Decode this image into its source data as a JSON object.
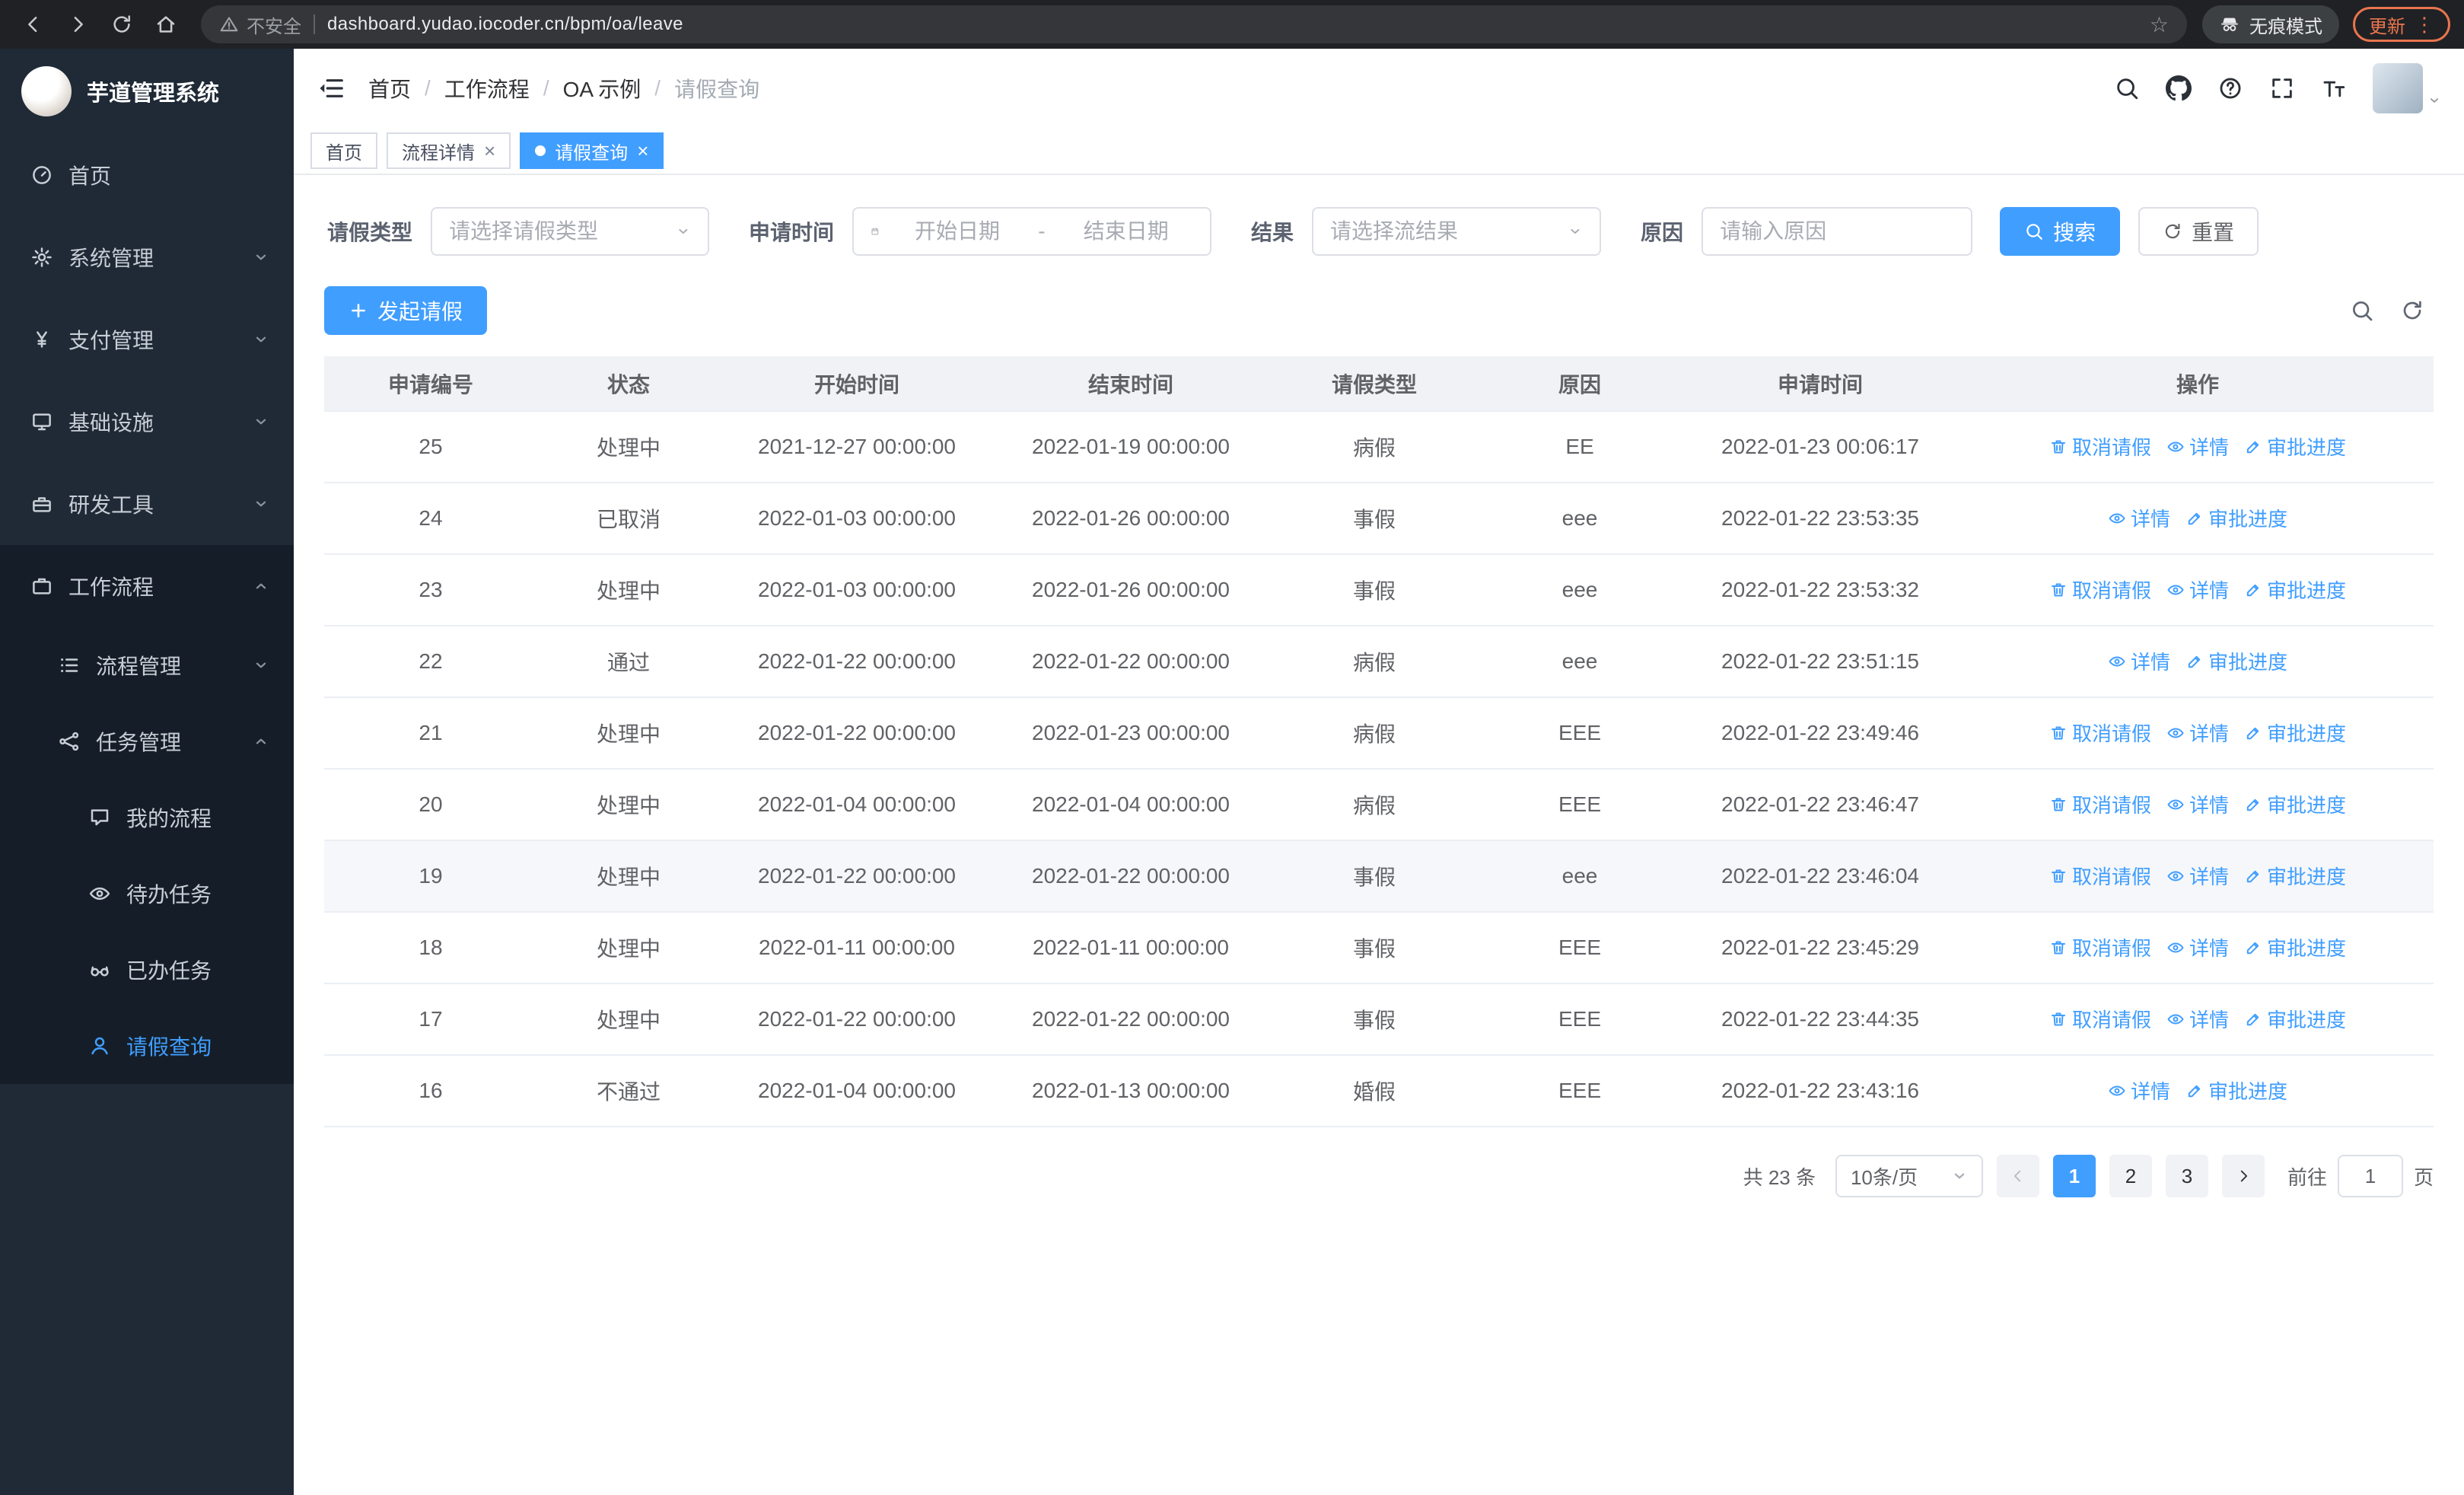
{
  "browser": {
    "security_label": "不安全",
    "url": "dashboard.yudao.iocoder.cn/bpm/oa/leave",
    "incognito_label": "无痕模式",
    "update_label": "更新"
  },
  "sidebar": {
    "title": "芋道管理系统",
    "items": [
      {
        "label": "首页",
        "icon": "dashboard-icon"
      },
      {
        "label": "系统管理",
        "icon": "gear-icon"
      },
      {
        "label": "支付管理",
        "icon": "yen-icon"
      },
      {
        "label": "基础设施",
        "icon": "monitor-icon"
      },
      {
        "label": "研发工具",
        "icon": "toolbox-icon"
      },
      {
        "label": "工作流程",
        "icon": "briefcase-icon"
      },
      {
        "label": "流程管理",
        "icon": "list-icon"
      },
      {
        "label": "任务管理",
        "icon": "node-icon"
      },
      {
        "label": "我的流程",
        "icon": "chat-icon"
      },
      {
        "label": "待办任务",
        "icon": "eye-icon"
      },
      {
        "label": "已办任务",
        "icon": "glasses-icon"
      },
      {
        "label": "请假查询",
        "icon": "user-icon"
      }
    ]
  },
  "header": {
    "breadcrumb": [
      "首页",
      "工作流程",
      "OA 示例",
      "请假查询"
    ],
    "icons": [
      "search-icon",
      "github-icon",
      "question-icon",
      "fullscreen-icon",
      "font-size-icon"
    ]
  },
  "tags": [
    {
      "label": "首页"
    },
    {
      "label": "流程详情"
    },
    {
      "label": "请假查询"
    }
  ],
  "filters": {
    "leave_type_label": "请假类型",
    "leave_type_placeholder": "请选择请假类型",
    "apply_time_label": "申请时间",
    "date_start_placeholder": "开始日期",
    "date_separator": "-",
    "date_end_placeholder": "结束日期",
    "result_label": "结果",
    "result_placeholder": "请选择流结果",
    "reason_label": "原因",
    "reason_placeholder": "请输入原因",
    "search_label": "搜索",
    "reset_label": "重置"
  },
  "toolbar": {
    "create_label": "发起请假"
  },
  "table": {
    "columns": [
      "申请编号",
      "状态",
      "开始时间",
      "结束时间",
      "请假类型",
      "原因",
      "申请时间",
      "操作"
    ],
    "action_labels": {
      "cancel": "取消请假",
      "detail": "详情",
      "progress": "审批进度"
    },
    "action_icons": {
      "cancel": "delete-icon",
      "detail": "view-icon",
      "progress": "edit-icon"
    },
    "rows": [
      {
        "id": "25",
        "status": "处理中",
        "start": "2021-12-27 00:00:00",
        "end": "2022-01-19 00:00:00",
        "type": "病假",
        "reason": "EE",
        "apply_time": "2022-01-23 00:06:17",
        "cancelable": true
      },
      {
        "id": "24",
        "status": "已取消",
        "start": "2022-01-03 00:00:00",
        "end": "2022-01-26 00:00:00",
        "type": "事假",
        "reason": "eee",
        "apply_time": "2022-01-22 23:53:35",
        "cancelable": false
      },
      {
        "id": "23",
        "status": "处理中",
        "start": "2022-01-03 00:00:00",
        "end": "2022-01-26 00:00:00",
        "type": "事假",
        "reason": "eee",
        "apply_time": "2022-01-22 23:53:32",
        "cancelable": true
      },
      {
        "id": "22",
        "status": "通过",
        "start": "2022-01-22 00:00:00",
        "end": "2022-01-22 00:00:00",
        "type": "病假",
        "reason": "eee",
        "apply_time": "2022-01-22 23:51:15",
        "cancelable": false
      },
      {
        "id": "21",
        "status": "处理中",
        "start": "2022-01-22 00:00:00",
        "end": "2022-01-23 00:00:00",
        "type": "病假",
        "reason": "EEE",
        "apply_time": "2022-01-22 23:49:46",
        "cancelable": true
      },
      {
        "id": "20",
        "status": "处理中",
        "start": "2022-01-04 00:00:00",
        "end": "2022-01-04 00:00:00",
        "type": "病假",
        "reason": "EEE",
        "apply_time": "2022-01-22 23:46:47",
        "cancelable": true
      },
      {
        "id": "19",
        "status": "处理中",
        "start": "2022-01-22 00:00:00",
        "end": "2022-01-22 00:00:00",
        "type": "事假",
        "reason": "eee",
        "apply_time": "2022-01-22 23:46:04",
        "cancelable": true,
        "highlighted": true
      },
      {
        "id": "18",
        "status": "处理中",
        "start": "2022-01-11 00:00:00",
        "end": "2022-01-11 00:00:00",
        "type": "事假",
        "reason": "EEE",
        "apply_time": "2022-01-22 23:45:29",
        "cancelable": true
      },
      {
        "id": "17",
        "status": "处理中",
        "start": "2022-01-22 00:00:00",
        "end": "2022-01-22 00:00:00",
        "type": "事假",
        "reason": "EEE",
        "apply_time": "2022-01-22 23:44:35",
        "cancelable": true
      },
      {
        "id": "16",
        "status": "不通过",
        "start": "2022-01-04 00:00:00",
        "end": "2022-01-13 00:00:00",
        "type": "婚假",
        "reason": "EEE",
        "apply_time": "2022-01-22 23:43:16",
        "cancelable": false
      }
    ]
  },
  "pagination": {
    "total": "共 23 条",
    "page_size": "10条/页",
    "pages": [
      "1",
      "2",
      "3"
    ],
    "active_page": "1",
    "goto_label": "前往",
    "goto_value": "1",
    "goto_unit": "页"
  }
}
